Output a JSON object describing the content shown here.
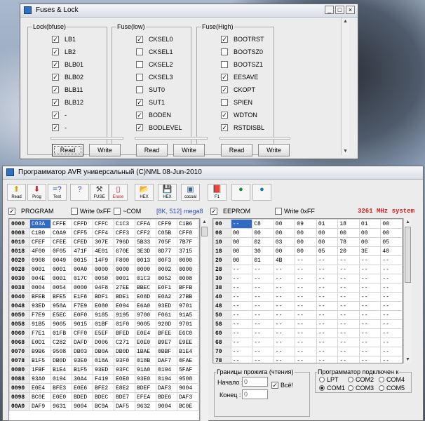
{
  "fuses_window": {
    "title": "Fuses & Lock",
    "controls": [
      "_",
      "□",
      "×"
    ],
    "groups": [
      {
        "label": "Lock(bfuse)",
        "items": [
          {
            "label": "LB1",
            "checked": true
          },
          {
            "label": "LB2",
            "checked": true
          },
          {
            "label": "BLB01",
            "checked": true
          },
          {
            "label": "BLB02",
            "checked": true
          },
          {
            "label": "BLB11",
            "checked": true
          },
          {
            "label": "BLB12",
            "checked": true
          },
          {
            "label": "-",
            "checked": true
          },
          {
            "label": "-",
            "checked": true
          }
        ],
        "read_label": "Read",
        "write_label": "Write"
      },
      {
        "label": "Fuse(low)",
        "items": [
          {
            "label": "CKSEL0",
            "checked": true
          },
          {
            "label": "CKSEL1",
            "checked": false
          },
          {
            "label": "CKSEL2",
            "checked": false
          },
          {
            "label": "CKSEL3",
            "checked": false
          },
          {
            "label": "SUT0",
            "checked": false
          },
          {
            "label": "SUT1",
            "checked": true
          },
          {
            "label": "BODEN",
            "checked": true
          },
          {
            "label": "BODLEVEL",
            "checked": true
          }
        ],
        "read_label": "Read",
        "write_label": "Write"
      },
      {
        "label": "Fuse(High)",
        "items": [
          {
            "label": "BOOTRST",
            "checked": true
          },
          {
            "label": "BOOTSZ0",
            "checked": false
          },
          {
            "label": "BOOTSZ1",
            "checked": false
          },
          {
            "label": "EESAVE",
            "checked": true
          },
          {
            "label": "CKOPT",
            "checked": true
          },
          {
            "label": "SPIEN",
            "checked": false
          },
          {
            "label": "WDTON",
            "checked": true
          },
          {
            "label": "RSTDISBL",
            "checked": true
          }
        ],
        "read_label": "Read",
        "write_label": "Write"
      }
    ]
  },
  "programmer_window": {
    "title": "Программатор AVR универсальный (C)NML 08-Jun-2010",
    "toolbar": [
      {
        "label": "Read",
        "icon": "arrow-up-icon",
        "glyph": "⬆",
        "color": "#d8a200"
      },
      {
        "label": "Prog",
        "icon": "arrow-down-icon",
        "glyph": "⬇",
        "color": "#cc1a1a"
      },
      {
        "label": "Test",
        "icon": "test-icon",
        "glyph": "=?",
        "color": "#1a3fb0"
      },
      {
        "label": "",
        "icon": "help-icon",
        "glyph": "?",
        "color": "#3050c0"
      },
      {
        "label": "FUSE",
        "icon": "tools-icon",
        "glyph": "⚒",
        "color": "#444444"
      },
      {
        "label": "Erase",
        "icon": "erase-icon",
        "glyph": "▯",
        "color": "#cc1a1a"
      },
      {
        "label": "HEX",
        "icon": "open-folder-icon",
        "glyph": "📂",
        "color": "#c08000"
      },
      {
        "label": "HEX",
        "icon": "save-icon",
        "glyph": "💾",
        "color": "#333333"
      },
      {
        "label": "cocoal",
        "icon": "terminal-icon",
        "glyph": "▣",
        "color": "#446688"
      },
      {
        "label": "F1",
        "icon": "book-icon",
        "glyph": "📕",
        "color": "#9a2060"
      },
      {
        "label": "",
        "icon": "stamp-icon",
        "glyph": "●",
        "color": "#1a8a3a"
      },
      {
        "label": "",
        "icon": "stamp2-icon",
        "glyph": "●",
        "color": "#1a7ab0"
      }
    ],
    "flash": {
      "program_label": "PROGRAM",
      "program_checked": true,
      "write_ff_label": "Write 0xFF",
      "write_ff_checked": false,
      "com_label": "~COM",
      "com_checked": false,
      "size_label": "[8K, 512]",
      "chip_label": "mega8",
      "rows": [
        [
          "0000",
          "C03A",
          "CFFE",
          "CFFD",
          "CFFC",
          "C1C3",
          "CFFA",
          "CFF9",
          "C1B6"
        ],
        [
          "0008",
          "C1B0",
          "C0A9",
          "CFF5",
          "CFF4",
          "CFF3",
          "CFF2",
          "C05B",
          "CFF0"
        ],
        [
          "0010",
          "CFEF",
          "CFEE",
          "CFED",
          "307E",
          "796D",
          "5B33",
          "705F",
          "7B7F"
        ],
        [
          "0018",
          "4F00",
          "0F05",
          "471F",
          "4E01",
          "670E",
          "3E3D",
          "0D77",
          "3715"
        ],
        [
          "0020",
          "0908",
          "0049",
          "0015",
          "14F9",
          "F800",
          "0013",
          "00F3",
          "0000"
        ],
        [
          "0028",
          "0001",
          "0001",
          "00A0",
          "0000",
          "0000",
          "0000",
          "0002",
          "0000"
        ],
        [
          "0030",
          "004E",
          "0001",
          "017C",
          "0050",
          "0001",
          "01C3",
          "0052",
          "0008"
        ],
        [
          "0038",
          "0004",
          "0054",
          "0000",
          "94F8",
          "27EE",
          "BBEC",
          "E0F1",
          "BFFB"
        ],
        [
          "0040",
          "BFEB",
          "BFE5",
          "E1F8",
          "BDF1",
          "BDE1",
          "E08D",
          "E0A2",
          "27BB"
        ],
        [
          "0048",
          "93ED",
          "958A",
          "F7E9",
          "E080",
          "E094",
          "E6A0",
          "93ED",
          "9701"
        ],
        [
          "0050",
          "F7E9",
          "E5EC",
          "E0F0",
          "9185",
          "9195",
          "9700",
          "F061",
          "91A5"
        ],
        [
          "0058",
          "91B5",
          "9005",
          "9015",
          "01BF",
          "01F0",
          "9005",
          "920D",
          "9701"
        ],
        [
          "0060",
          "F7E1",
          "01FB",
          "CFF0",
          "E5EF",
          "BFED",
          "E0E4",
          "BFEE",
          "E6C0"
        ],
        [
          "0068",
          "E0D1",
          "C282",
          "DAFD",
          "D006",
          "C271",
          "E0E0",
          "B9E7",
          "E9EE"
        ],
        [
          "0070",
          "B9B6",
          "9508",
          "DB03",
          "DB0A",
          "DB0D",
          "1BAE",
          "0BBF",
          "B1E4"
        ],
        [
          "0078",
          "B1F5",
          "DB0D",
          "93E0",
          "018A",
          "93F0",
          "018B",
          "DAF7",
          "0FAE"
        ],
        [
          "0080",
          "1FBF",
          "B1E4",
          "B1F5",
          "93ED",
          "93FC",
          "91A0",
          "0194",
          "5FAF"
        ],
        [
          "0088",
          "93A0",
          "0194",
          "30A4",
          "F419",
          "E0E0",
          "93E0",
          "0194",
          "9508"
        ],
        [
          "0090",
          "E0E4",
          "BFE3",
          "E0E6",
          "BFE2",
          "E8E2",
          "BDEF",
          "DAF3",
          "9004"
        ],
        [
          "0098",
          "BC0E",
          "E0E0",
          "BDED",
          "BDEC",
          "BDE7",
          "EFEA",
          "BDE6",
          "DAF3"
        ],
        [
          "00A0",
          "DAF9",
          "9631",
          "9004",
          "BC9A",
          "DAF5",
          "9632",
          "9004",
          "BC0E"
        ]
      ]
    },
    "eeprom": {
      "label": "EEPROM",
      "checked": true,
      "write_ff_label": "Write 0xFF",
      "write_ff_checked": false,
      "speed_label": "3261 MHz system",
      "rows": [
        [
          "00",
          "--",
          "C8",
          "00",
          "09",
          "01",
          "18",
          "01",
          "00"
        ],
        [
          "08",
          "00",
          "00",
          "00",
          "00",
          "00",
          "00",
          "00",
          "00"
        ],
        [
          "10",
          "00",
          "02",
          "03",
          "00",
          "00",
          "78",
          "00",
          "05"
        ],
        [
          "18",
          "00",
          "30",
          "00",
          "00",
          "05",
          "20",
          "3E",
          "40"
        ],
        [
          "20",
          "00",
          "01",
          "4B",
          "--",
          "--",
          "--",
          "--",
          "--"
        ],
        [
          "28",
          "--",
          "--",
          "--",
          "--",
          "--",
          "--",
          "--",
          "--"
        ],
        [
          "30",
          "--",
          "--",
          "--",
          "--",
          "--",
          "--",
          "--",
          "--"
        ],
        [
          "38",
          "--",
          "--",
          "--",
          "--",
          "--",
          "--",
          "--",
          "--"
        ],
        [
          "40",
          "--",
          "--",
          "--",
          "--",
          "--",
          "--",
          "--",
          "--"
        ],
        [
          "48",
          "--",
          "--",
          "--",
          "--",
          "--",
          "--",
          "--",
          "--"
        ],
        [
          "50",
          "--",
          "--",
          "--",
          "--",
          "--",
          "--",
          "--",
          "--"
        ],
        [
          "58",
          "--",
          "--",
          "--",
          "--",
          "--",
          "--",
          "--",
          "--"
        ],
        [
          "60",
          "--",
          "--",
          "--",
          "--",
          "--",
          "--",
          "--",
          "--"
        ],
        [
          "68",
          "--",
          "--",
          "--",
          "--",
          "--",
          "--",
          "--",
          "--"
        ],
        [
          "70",
          "--",
          "--",
          "--",
          "--",
          "--",
          "--",
          "--",
          "--"
        ],
        [
          "78",
          "--",
          "--",
          "--",
          "--",
          "--",
          "--",
          "--",
          "--"
        ]
      ]
    },
    "range": {
      "label": "Границы прожига (чтения)",
      "start_label": "Начало :",
      "start_value": "0",
      "end_label": "Конец :",
      "end_value": "0",
      "all_label": "Всё!",
      "all_checked": true
    },
    "connection": {
      "label": "Программатор подключен к",
      "options": [
        {
          "label": "LPT",
          "selected": false
        },
        {
          "label": "COM2",
          "selected": false
        },
        {
          "label": "COM4",
          "selected": false
        },
        {
          "label": "COM1",
          "selected": true
        },
        {
          "label": "COM3",
          "selected": false
        },
        {
          "label": "COM5",
          "selected": false
        }
      ]
    },
    "colors": {
      "speed_text": "#d81b1b",
      "chip_text": "#2a4fc2",
      "selection": "#316ac5"
    }
  }
}
